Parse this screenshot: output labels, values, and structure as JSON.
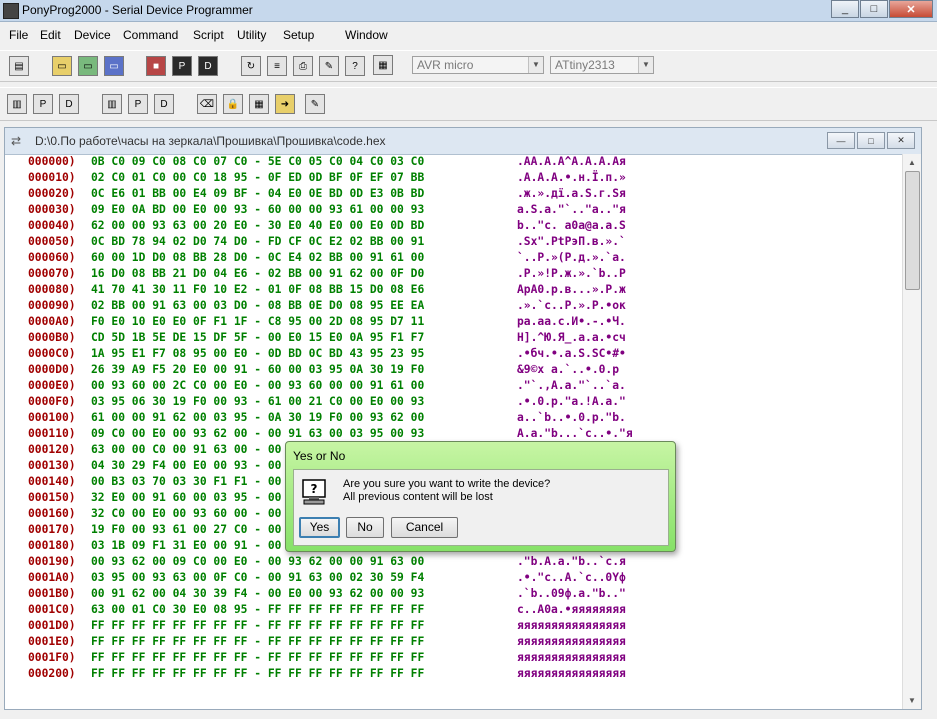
{
  "window": {
    "title": "PonyProg2000 - Serial Device Programmer",
    "controls": [
      "_",
      "□",
      "✕"
    ]
  },
  "menu": [
    "File",
    "Edit",
    "Device",
    "Command",
    "Script",
    "Utility",
    "Setup",
    "Window"
  ],
  "toolbar": {
    "device_family": "AVR micro",
    "device_type": "ATtiny2313",
    "command_input": ""
  },
  "document": {
    "path": "D:\\0.По работе\\часы на зеркала\\Прошивка\\Прошивка\\code.hex",
    "controls": [
      "—",
      "□",
      "✕"
    ],
    "rows": [
      {
        "addr": "000000)",
        "bytes": "0B C0 09 C0 08 C0 07 C0 - 5E C0 05 C0 04 C0 03 C0",
        "ascii": ".AA.A.A^A.A.A.Aя"
      },
      {
        "addr": "000010)",
        "bytes": "02 C0 01 C0 00 C0 18 95 - 0F ED 0D BF 0F EF 07 BB",
        "ascii": ".A.A.A.•.н.Ї.п.»"
      },
      {
        "addr": "000020)",
        "bytes": "0C E6 01 BB 00 E4 09 BF - 04 E0 0E BD 0D E3 0B BD",
        "ascii": ".ж.».дї.а.Ѕ.г.Ѕя"
      },
      {
        "addr": "000030)",
        "bytes": "09 E0 0A BD 00 E0 00 93 - 60 00 00 93 61 00 00 93",
        "ascii": "а.Ѕ.а.\"`..\"a..\"я"
      },
      {
        "addr": "000040)",
        "bytes": "62 00 00 93 63 00 20 E0 - 30 E0 40 E0 00 E0 0D BD",
        "ascii": "b..\"c. а0а@а.а.Ѕ"
      },
      {
        "addr": "000050)",
        "bytes": "0C BD 78 94 02 D0 74 D0 - FD CF 0C E2 02 BB 00 91",
        "ascii": ".Ѕx\".РtРэП.в.».`"
      },
      {
        "addr": "000060)",
        "bytes": "60 00 1D D0 08 BB 28 D0 - 0C E4 02 BB 00 91 61 00",
        "ascii": "`..Р.»(Р.д.».`a."
      },
      {
        "addr": "000070)",
        "bytes": "16 D0 08 BB 21 D0 04 E6 - 02 BB 00 91 62 00 0F D0",
        "ascii": ".Р.»!Р.ж.».`b..Р"
      },
      {
        "addr": "000080)",
        "bytes": "41 70 41 30 11 F0 10 E2 - 01 0F 08 BB 15 D0 08 E6",
        "ascii": "ApA0.р.в...».Р.ж"
      },
      {
        "addr": "000090)",
        "bytes": "02 BB 00 91 63 00 03 D0 - 08 BB 0E D0 08 95 EE EA",
        "ascii": ".».`c..Р.».Р.•ок"
      },
      {
        "addr": "0000A0)",
        "bytes": "F0 E0 10 E0 E0 0F F1 1F - C8 95 00 2D 08 95 D7 11",
        "ascii": "ра.аа.с.И•.-.•Ч."
      },
      {
        "addr": "0000B0)",
        "bytes": "CD 5D 1B 5E DE 15 DF 5F - 00 E0 15 E0 0A 95 F1 F7",
        "ascii": "Н].^Ю.Я_.а.а.•сч"
      },
      {
        "addr": "0000C0)",
        "bytes": "1A 95 E1 F7 08 95 00 E0 - 0D BD 0C BD 43 95 23 95",
        "ascii": ".•бч.•.а.Ѕ.ЅC•#•"
      },
      {
        "addr": "0000D0)",
        "bytes": "26 39 A9 F5 20 E0 00 91 - 60 00 03 95 0A 30 19 F0",
        "ascii": "&9©х а.`..•.0.р"
      },
      {
        "addr": "0000E0)",
        "bytes": "00 93 60 00 2C C0 00 E0 - 00 93 60 00 00 91 61 00",
        "ascii": ".\"`.,A.а.\"`..`a."
      },
      {
        "addr": "0000F0)",
        "bytes": "03 95 06 30 19 F0 00 93 - 61 00 21 C0 00 E0 00 93",
        "ascii": ".•.0.р.\"a.!A.а.\""
      },
      {
        "addr": "000100)",
        "bytes": "61 00 00 91 62 00 03 95 - 0A 30 19 F0 00 93 62 00",
        "ascii": "a..`b..•.0.р.\"b."
      },
      {
        "addr": "000110)",
        "bytes": "09 C0 00 E0 00 93 62 00 - 00 91 63 00 03 95 00 93",
        "ascii": "A.a.\"b...`c..•.\"я"
      },
      {
        "addr": "000120)",
        "bytes": "63 00 00 C0 00 91 63 00 - 00 00 00 00 00 00 00 00",
        "ascii": "c..A.`c.........."
      },
      {
        "addr": "000130)",
        "bytes": "04 30 29 F4 00 E0 00 93 - 00 00 00 00 00 00 00 00",
        "ascii": ".0)ф.а.\"........"
      },
      {
        "addr": "000140)",
        "bytes": "00 B3 03 70 03 30 F1 F1 - 00 00 00 00 00 00 00 00",
        "ascii": ".і.p.0сс........"
      },
      {
        "addr": "000150)",
        "bytes": "32 E0 00 91 60 00 03 95 - 00 00 00 00 00 00 00 00",
        "ascii": "2а.`..•........."
      },
      {
        "addr": "000160)",
        "bytes": "32 C0 00 E0 00 93 60 00 - 00 00 00 00 00 00 00 00",
        "ascii": "2A.а.\"`........."
      },
      {
        "addr": "000170)",
        "bytes": "19 F0 00 93 61 00 27 C0 - 00 00 00 00 00 00 00 00",
        "ascii": ".р.\"a.'A........"
      },
      {
        "addr": "000180)",
        "bytes": "03 1B 09 F1 31 E0 00 91 - 00 00 00 00 00 00 00 00",
        "ascii": "...с1а.`........"
      },
      {
        "addr": "000190)",
        "bytes": "00 93 62 00 09 C0 00 E0 - 00 93 62 00 00 91 63 00",
        "ascii": ".\"b.A.a.\"b..`c.я"
      },
      {
        "addr": "0001A0)",
        "bytes": "03 95 00 93 63 00 0F C0 - 00 91 63 00 02 30 59 F4",
        "ascii": ".•.\"c..A.`c..0Yф"
      },
      {
        "addr": "0001B0)",
        "bytes": "00 91 62 00 04 30 39 F4 - 00 E0 00 93 62 00 00 93",
        "ascii": ".`b..09ф.а.\"b..\""
      },
      {
        "addr": "0001C0)",
        "bytes": "63 00 01 C0 30 E0 08 95 - FF FF FF FF FF FF FF FF",
        "ascii": "c..A0а.•яяяяяяяя"
      },
      {
        "addr": "0001D0)",
        "bytes": "FF FF FF FF FF FF FF FF - FF FF FF FF FF FF FF FF",
        "ascii": "яяяяяяяяяяяяяяяя"
      },
      {
        "addr": "0001E0)",
        "bytes": "FF FF FF FF FF FF FF FF - FF FF FF FF FF FF FF FF",
        "ascii": "яяяяяяяяяяяяяяяя"
      },
      {
        "addr": "0001F0)",
        "bytes": "FF FF FF FF FF FF FF FF - FF FF FF FF FF FF FF FF",
        "ascii": "яяяяяяяяяяяяяяяя"
      },
      {
        "addr": "000200)",
        "bytes": "FF FF FF FF FF FF FF FF - FF FF FF FF FF FF FF FF",
        "ascii": "яяяяяяяяяяяяяяяя"
      }
    ]
  },
  "dialog": {
    "title": "Yes or No",
    "line1": "Are you sure you want to write the device?",
    "line2": "All previous content will be lost",
    "yes": "Yes",
    "no": "No",
    "cancel": "Cancel"
  }
}
